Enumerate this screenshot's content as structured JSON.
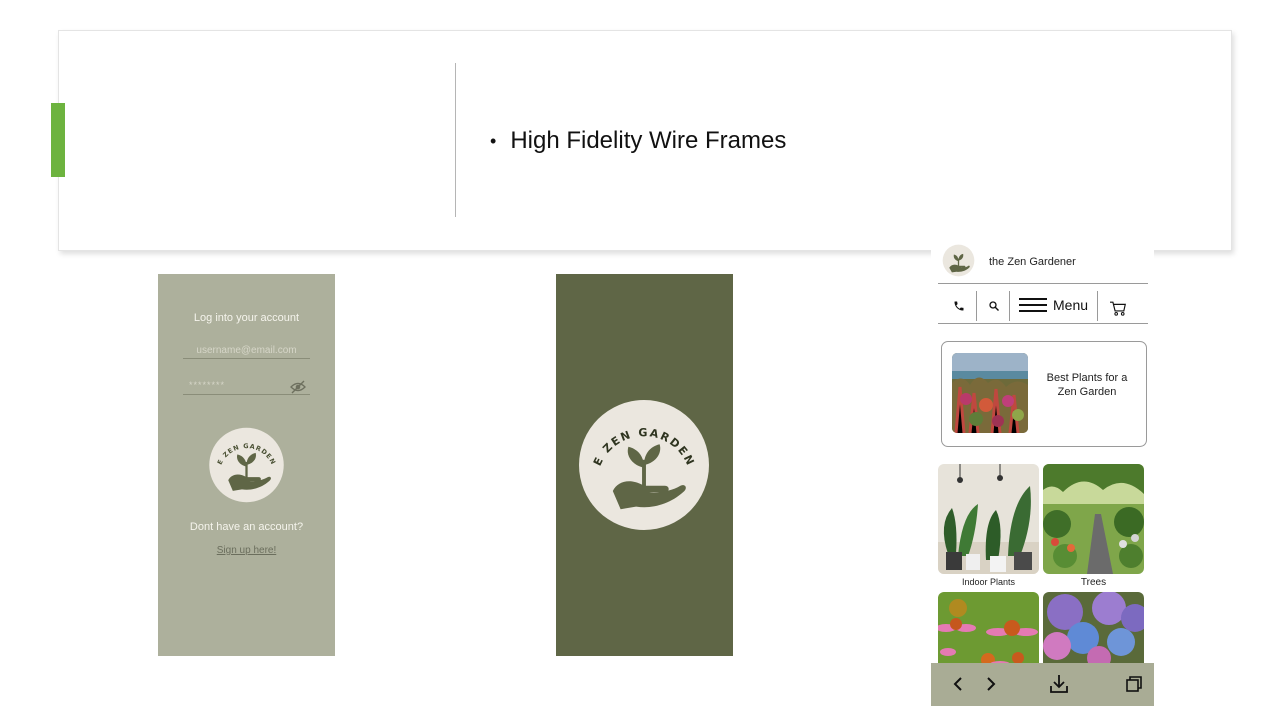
{
  "slide": {
    "bullet": "High Fidelity Wire Frames",
    "accent_color": "#6db33f"
  },
  "login_screen": {
    "title": "Log into your account",
    "username_placeholder": "username@email.com",
    "password_mask": "********",
    "no_account_text": "Dont have an account?",
    "signup_link": "Sign up here!",
    "background": "#adb09c",
    "logo_text": "THE ZEN GARDENER"
  },
  "splash_screen": {
    "background": "#5f6646",
    "logo_text": "THE ZEN GARDENER"
  },
  "store_screen": {
    "brand": "the Zen Gardener",
    "menu_label": "Menu",
    "feature_text": "Best Plants for a Zen Garden",
    "categories": [
      {
        "label": "Indoor Plants"
      },
      {
        "label": "Trees"
      }
    ],
    "toolbar_color": "#a9ac95",
    "icons": [
      "phone-icon",
      "search-icon",
      "hamburger-icon",
      "cart-icon",
      "back-icon",
      "forward-icon",
      "download-icon",
      "tabs-icon"
    ]
  }
}
